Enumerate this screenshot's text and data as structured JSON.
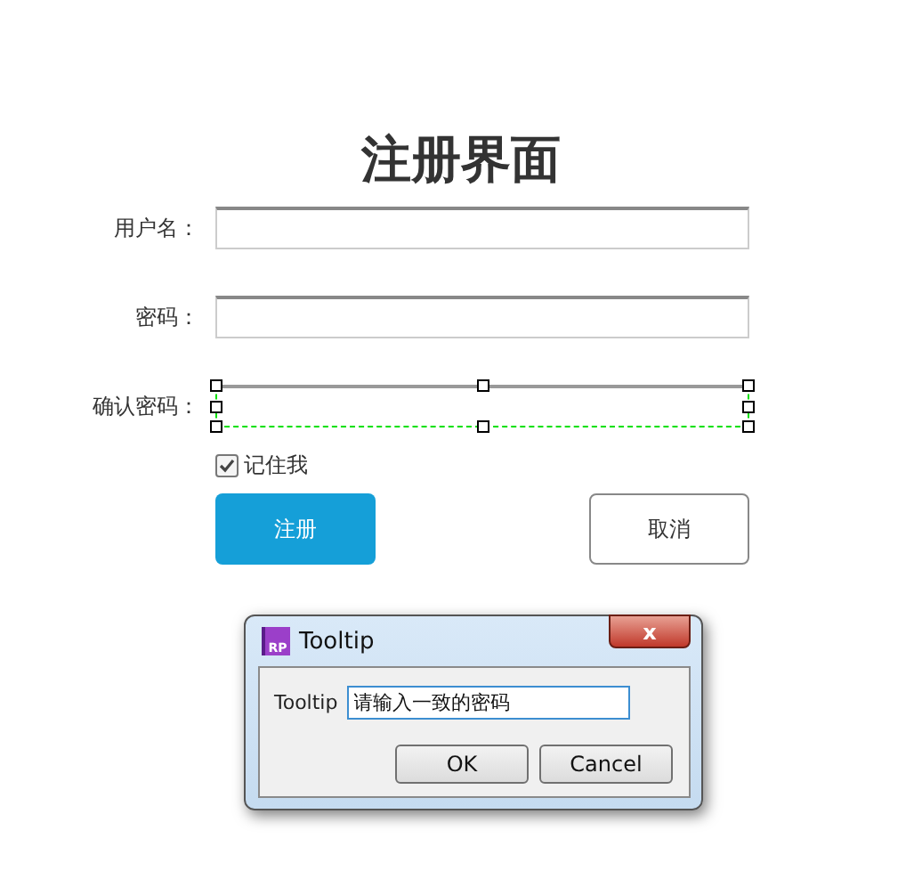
{
  "title": "注册界面",
  "fields": [
    {
      "label": "用户名：",
      "selected": false
    },
    {
      "label": "密码：",
      "selected": false
    },
    {
      "label": "确认密码：",
      "selected": true
    }
  ],
  "remember": {
    "label": "记住我",
    "checked": true
  },
  "buttons": [
    {
      "label": "注册",
      "kind": "primary"
    },
    {
      "label": "取消",
      "kind": "secondary"
    }
  ],
  "dialog": {
    "app_icon": "RP",
    "title": "Tooltip",
    "close": "x",
    "field_label": "Tooltip",
    "field_value": "请输入一致的密码",
    "buttons": [
      "OK",
      "Cancel"
    ]
  }
}
